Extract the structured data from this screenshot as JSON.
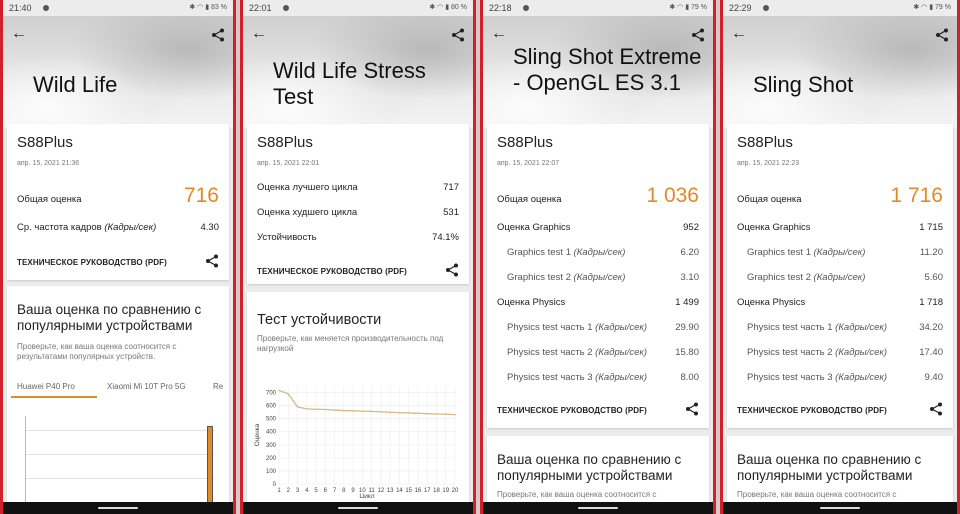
{
  "screens": [
    {
      "time": "21:40",
      "battery": "83 %",
      "title": "Wild Life",
      "device": "S88Plus",
      "date": "апр. 15, 2021 21:36",
      "overall_label": "Общая оценка",
      "overall_value": "716",
      "fps_label": "Ср. частота кадров ",
      "fps_unit": "(Кадры/сек)",
      "fps_value": "4.30",
      "guide": "ТЕХНИЧЕСКОЕ РУКОВОДСТВО (PDF)",
      "compare_title": "Ваша оценка по сравнению с популярными устройствами",
      "compare_desc": "Проверьте, как ваша оценка соотносится с результатами популярных устройств.",
      "tabs": [
        "Huawei P40 Pro",
        "Xiaomi Mi 10T Pro 5G",
        "Re"
      ]
    },
    {
      "time": "22:01",
      "battery": "80 %",
      "title": "Wild Life Stress Test",
      "device": "S88Plus",
      "date": "апр. 15, 2021 22:01",
      "rows": [
        {
          "label": "Оценка лучшего цикла",
          "value": "717"
        },
        {
          "label": "Оценка худшего цикла",
          "value": "531"
        },
        {
          "label": "Устойчивость",
          "value": "74.1%"
        }
      ],
      "guide": "ТЕХНИЧЕСКОЕ РУКОВОДСТВО (PDF)",
      "stability_title": "Тест устойчивости",
      "stability_desc": "Проверьте, как меняется производительность под нагрузкой"
    },
    {
      "time": "22:18",
      "battery": "79 %",
      "title": "Sling Shot Extreme - OpenGL ES 3.1",
      "device": "S88Plus",
      "date": "апр. 15, 2021 22:07",
      "overall_label": "Общая оценка",
      "overall_value": "1 036",
      "rows": [
        {
          "label": "Оценка Graphics",
          "value": "952",
          "sub": false
        },
        {
          "label": "Graphics test 1 ",
          "unit": "(Кадры/сек)",
          "value": "6.20",
          "sub": true
        },
        {
          "label": "Graphics test 2 ",
          "unit": "(Кадры/сек)",
          "value": "3.10",
          "sub": true
        },
        {
          "label": "Оценка Physics",
          "value": "1 499",
          "sub": false
        },
        {
          "label": "Physics test часть 1 ",
          "unit": "(Кадры/сек)",
          "value": "29.90",
          "sub": true
        },
        {
          "label": "Physics test часть 2 ",
          "unit": "(Кадры/сек)",
          "value": "15.80",
          "sub": true
        },
        {
          "label": "Physics test часть 3 ",
          "unit": "(Кадры/сек)",
          "value": "8.00",
          "sub": true
        }
      ],
      "guide": "ТЕХНИЧЕСКОЕ РУКОВОДСТВО (PDF)",
      "compare_title": "Ваша оценка по сравнению с популярными устройствами",
      "compare_desc": "Проверьте, как ваша оценка соотносится с"
    },
    {
      "time": "22:29",
      "battery": "79 %",
      "title": "Sling Shot",
      "device": "S88Plus",
      "date": "апр. 15, 2021 22:23",
      "overall_label": "Общая оценка",
      "overall_value": "1 716",
      "rows": [
        {
          "label": "Оценка Graphics",
          "value": "1 715",
          "sub": false
        },
        {
          "label": "Graphics test 1 ",
          "unit": "(Кадры/сек)",
          "value": "11.20",
          "sub": true
        },
        {
          "label": "Graphics test 2 ",
          "unit": "(Кадры/сек)",
          "value": "5.60",
          "sub": true
        },
        {
          "label": "Оценка Physics",
          "value": "1 718",
          "sub": false
        },
        {
          "label": "Physics test часть 1 ",
          "unit": "(Кадры/сек)",
          "value": "34.20",
          "sub": true
        },
        {
          "label": "Physics test часть 2 ",
          "unit": "(Кадры/сек)",
          "value": "17.40",
          "sub": true
        },
        {
          "label": "Physics test часть 3 ",
          "unit": "(Кадры/сек)",
          "value": "9.40",
          "sub": true
        }
      ],
      "guide": "ТЕХНИЧЕСКОЕ РУКОВОДСТВО (PDF)",
      "compare_title": "Ваша оценка по сравнению с популярными устройствами",
      "compare_desc": "Проверьте, как ваша оценка соотносится с"
    }
  ],
  "colors": {
    "accent": "#e08a2a",
    "frame": "#d0202a",
    "chart_line": "#d9b98a",
    "tab_underline": "#e08a2a"
  },
  "chart_data": {
    "type": "line",
    "title": "",
    "xlabel": "Цикл",
    "ylabel": "Оценка",
    "x": [
      1,
      2,
      3,
      4,
      5,
      6,
      7,
      8,
      9,
      10,
      11,
      12,
      13,
      14,
      15,
      16,
      17,
      18,
      19,
      20
    ],
    "series": [
      {
        "values": [
          717,
          690,
          590,
          575,
          572,
          570,
          566,
          562,
          560,
          558,
          556,
          552,
          549,
          546,
          544,
          541,
          538,
          536,
          534,
          531
        ]
      }
    ],
    "ylim": [
      0,
      750
    ],
    "yticks": [
      0,
      100,
      200,
      300,
      400,
      500,
      600,
      700
    ],
    "grid": true
  }
}
